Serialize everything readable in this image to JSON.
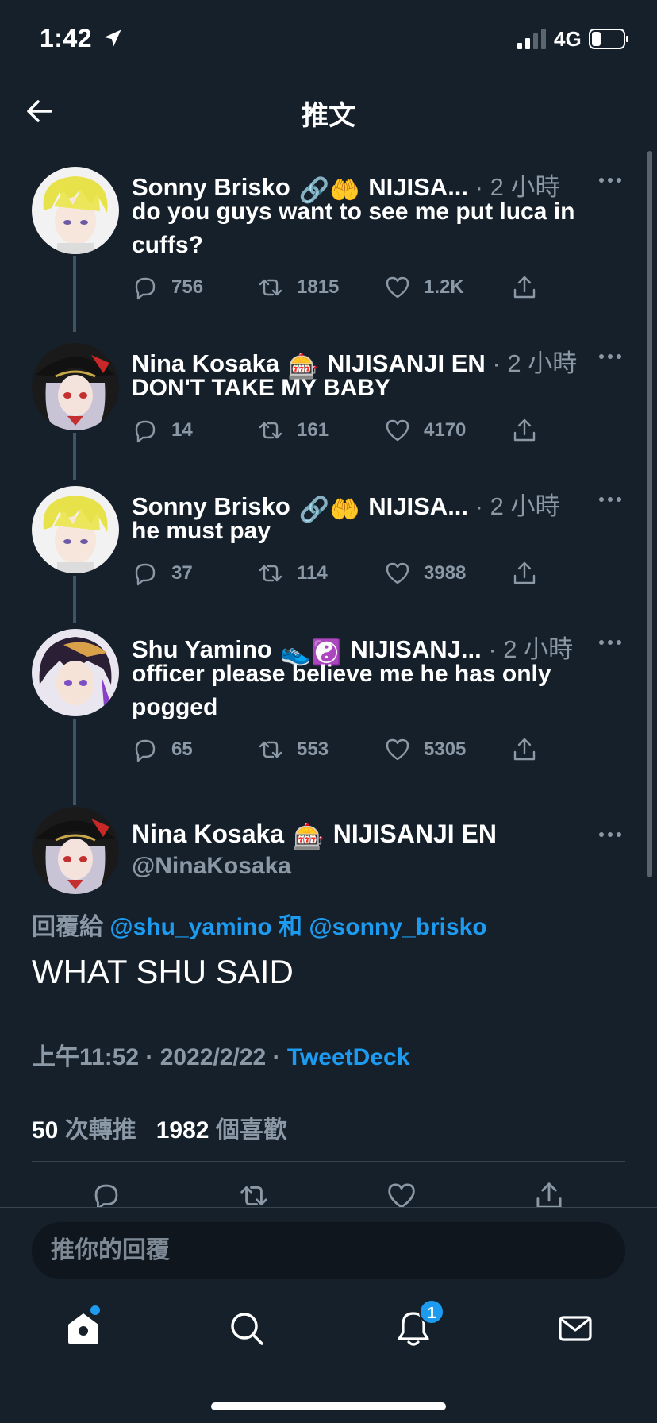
{
  "status_bar": {
    "time": "1:42",
    "network": "4G"
  },
  "nav": {
    "title": "推文"
  },
  "thread": [
    {
      "name": "Sonny Brisko",
      "emojis": "🔗🤲",
      "org": "NIJISA...",
      "time": "· 2 小時",
      "text": "do you guys want to see me put luca in cuffs?",
      "replies": "756",
      "retweets": "1815",
      "likes": "1.2K",
      "avatar": "blonde"
    },
    {
      "name": "Nina Kosaka",
      "emojis": "🎰",
      "org": "NIJISANJI EN",
      "time": "· 2 小時",
      "text": "DON'T TAKE MY BABY",
      "replies": "14",
      "retweets": "161",
      "likes": "4170",
      "avatar": "witch"
    },
    {
      "name": "Sonny Brisko",
      "emojis": "🔗🤲",
      "org": "NIJISA...",
      "time": "· 2 小時",
      "text": "he must pay",
      "replies": "37",
      "retweets": "114",
      "likes": "3988",
      "avatar": "blonde"
    },
    {
      "name": "Shu Yamino",
      "emojis": "👟☯️",
      "org": "NIJISANJ...",
      "time": "· 2 小時",
      "text": "officer please believe me he has only pogged",
      "replies": "65",
      "retweets": "553",
      "likes": "5305",
      "avatar": "dark"
    }
  ],
  "main_tweet": {
    "name": "Nina Kosaka",
    "emojis": "🎰",
    "org": "NIJISANJI EN",
    "handle": "@NinaKosaka",
    "replying_prefix": "回覆給",
    "replying_user1": "@shu_yamino",
    "replying_and": "和",
    "replying_user2": "@sonny_brisko",
    "text": "WHAT SHU SAID",
    "time": "上午11:52 · 2022/2/22 ·",
    "source": "TweetDeck",
    "retweet_count": "50",
    "retweet_label": "次轉推",
    "like_count": "1982",
    "like_label": "個喜歡"
  },
  "reply_box": {
    "placeholder": "推你的回覆"
  },
  "tabbar": {
    "notification_badge": "1"
  },
  "colors": {
    "background": "#15202b",
    "accent": "#1d9bf0",
    "muted": "#8b98a5"
  }
}
